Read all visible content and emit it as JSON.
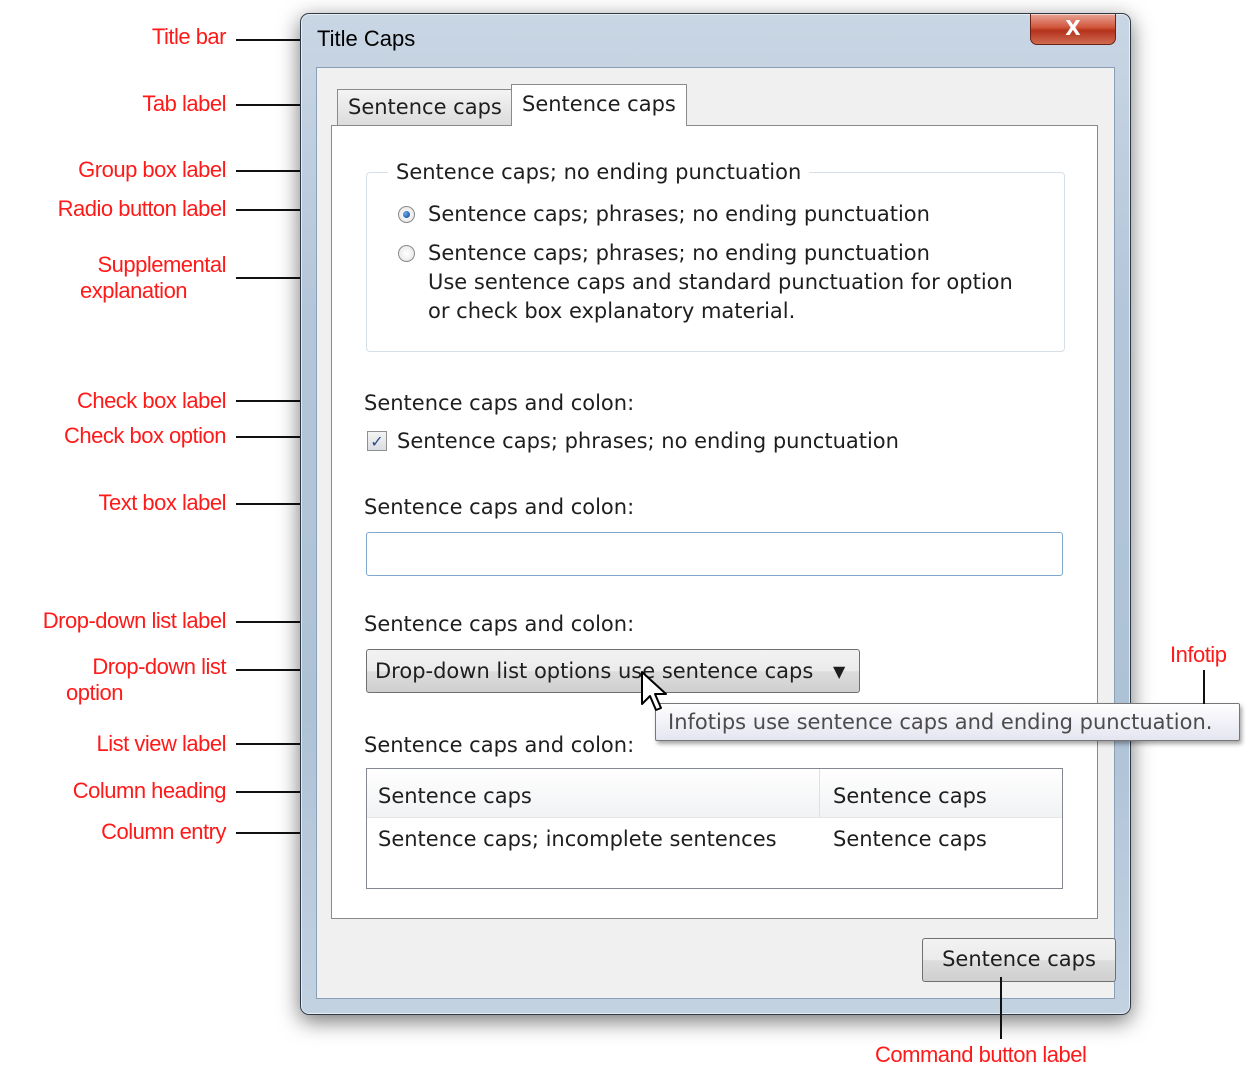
{
  "window": {
    "title": "Title Caps",
    "close_glyph": "X"
  },
  "tabs": [
    {
      "label": "Sentence caps",
      "selected": false
    },
    {
      "label": "Sentence caps",
      "selected": true
    }
  ],
  "group": {
    "label": "Sentence caps; no ending punctuation",
    "radio1": "Sentence caps; phrases;  no ending punctuation",
    "radio2": "Sentence caps; phrases;  no ending punctuation",
    "explanation_line1": "Use sentence caps and standard punctuation for option",
    "explanation_line2": "or check box explanatory material.",
    "radio1_selected": true
  },
  "checkbox": {
    "heading": "Sentence caps and colon:",
    "label": "Sentence caps; phrases;  no ending punctuation",
    "checked": true,
    "check_glyph": "✓"
  },
  "textbox": {
    "label": "Sentence caps and colon:",
    "value": ""
  },
  "dropdown": {
    "label": "Sentence caps and colon:",
    "selected": "Drop-down list options use sentence caps",
    "arrow_glyph": "▼"
  },
  "listview": {
    "label": "Sentence caps and colon:",
    "columns": [
      "Sentence caps",
      "Sentence caps"
    ],
    "rows": [
      [
        "Sentence caps; incomplete sentences",
        "Sentence caps"
      ]
    ]
  },
  "infotip": "Infotips use sentence caps and ending punctuation.",
  "command_button": "Sentence caps",
  "annotations": {
    "title_bar": "Title bar",
    "tab_label": "Tab label",
    "group_box_label": "Group box label",
    "radio_button_label": "Radio button label",
    "supplemental_line1": "Supplemental",
    "supplemental_line2": "explanation",
    "check_box_label": "Check box label",
    "check_box_option": "Check box option",
    "text_box_label": "Text box label",
    "drop_down_list_label": "Drop-down list label",
    "drop_down_option_line1": "Drop-down list",
    "drop_down_option_line2": "option",
    "list_view_label": "List view label",
    "column_heading": "Column heading",
    "column_entry": "Column entry",
    "infotip": "Infotip",
    "command_button_label": "Command button label"
  },
  "colors": {
    "annotation": "#ff1a1a",
    "window_frame": "#b4c6d9",
    "close_button": "#c8462e"
  }
}
